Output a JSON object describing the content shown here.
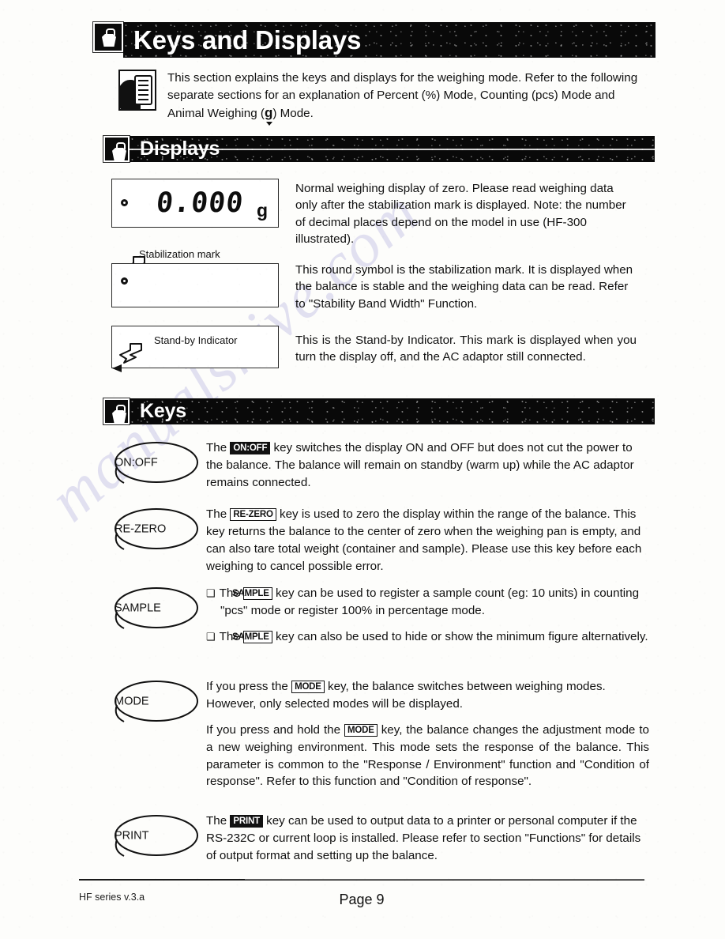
{
  "document": {
    "footer_left": "HF series v.3.a",
    "footer_center": "Page 9"
  },
  "watermark": {
    "text": "manualshive.com"
  },
  "headers": {
    "main": "Keys and Displays",
    "displays": "Displays",
    "keys": "Keys"
  },
  "intro": {
    "text": "This section explains the keys and displays for the weighing mode. Refer to the following separate sections for an explanation of Percent (%) Mode, Counting (pcs) Mode and Animal Weighing (",
    "g_symbol": "g",
    "text_end": ") Mode."
  },
  "displays": {
    "lcd_zero": {
      "value": "0.000",
      "unit": "g",
      "description": "Normal weighing display of zero. Please read weighing data only after the stabilization mark is displayed. Note: the number of decimal places depend on the model in use (HF-300 illustrated)."
    },
    "lcd_stabilization": {
      "label": "Stabilization mark",
      "description": "This round symbol is the stabilization mark. It is displayed when the balance is stable and the weighing data can be read. Refer to \"Stability Band Width\" Function."
    },
    "lcd_standby": {
      "label": "Stand-by Indicator",
      "description": "This is the Stand-by Indicator. This mark is displayed when you turn the display off, and the AC adaptor still connected."
    }
  },
  "keys": [
    {
      "name": "ON:OFF",
      "cap": "ON:OFF",
      "paragraphs": [
        {
          "pre": "The ",
          "cap": "ON:OFF",
          "post": " key switches the display ON and OFF but does not cut the power to the balance. The balance will remain on standby (warm up) while the AC adaptor remains connected."
        }
      ]
    },
    {
      "name": "RE-ZERO",
      "cap": "RE-ZERO",
      "paragraphs": [
        {
          "pre": "The ",
          "cap": "RE-ZERO",
          "post": " key is used to zero the display within the range of the balance. This key returns the balance to the center of zero when the weighing pan is empty, and can also tare total weight (container and sample). Please use this key before each weighing to cancel possible error."
        }
      ]
    },
    {
      "name": "SAMPLE",
      "cap": "SAMPLE",
      "bullet": "❑",
      "bullets": [
        {
          "pre": "The ",
          "cap": "SAMPLE",
          "post": " key can be used to register a sample count (eg: 10 units) in counting \"pcs\" mode or register 100% in percentage mode."
        },
        {
          "pre": "The ",
          "cap": "SAMPLE",
          "post": " key can also be used to hide or show  the minimum figure alternatively."
        }
      ]
    },
    {
      "name": "MODE",
      "cap": "MODE",
      "paragraphs": [
        {
          "pre": "If you press the ",
          "cap": "MODE",
          "post": " key, the balance switches between weighing modes. However, only selected modes will be displayed."
        },
        {
          "pre": "If you press and hold the ",
          "cap": "MODE",
          "post": " key, the balance changes the adjustment mode to a new weighing environment. This mode sets the response of the balance. This parameter is common to the \"Response / Environment\" function and \"Condition of response\". Refer to this function and \"Condition of response\"."
        }
      ]
    },
    {
      "name": "PRINT",
      "cap": "PRINT",
      "paragraphs": [
        {
          "pre": "The ",
          "cap": "PRINT",
          "post": " key can be used to output data to a printer or personal computer if the RS-232C or current loop is installed. Please refer to section \"Functions\" for details of output format and setting up the balance."
        }
      ]
    }
  ]
}
